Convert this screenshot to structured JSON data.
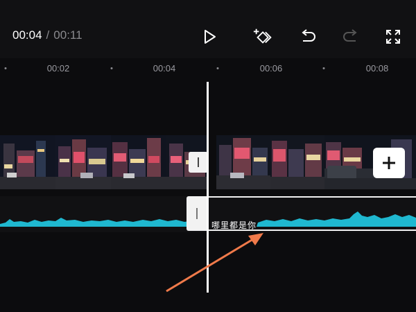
{
  "header": {
    "current_time": "00:04",
    "separator": "/",
    "total_time": "00:11"
  },
  "toolbar": {
    "buttons": [
      {
        "name": "play",
        "icon": "play-icon"
      },
      {
        "name": "keyframe",
        "icon": "add-keyframe-icon"
      },
      {
        "name": "undo",
        "icon": "undo-icon"
      },
      {
        "name": "redo",
        "icon": "redo-icon"
      },
      {
        "name": "fullscreen",
        "icon": "fullscreen-icon"
      }
    ]
  },
  "ruler": {
    "labels": [
      "00:02",
      "00:04",
      "00:06",
      "00:08"
    ]
  },
  "timeline": {
    "add_clip_icon": "plus-icon",
    "audio_clip_text": "哪里都是你"
  },
  "colors": {
    "background": "#0c0c0e",
    "waveform": "#1fb8d0",
    "annotation_arrow": "#f07a4a"
  }
}
